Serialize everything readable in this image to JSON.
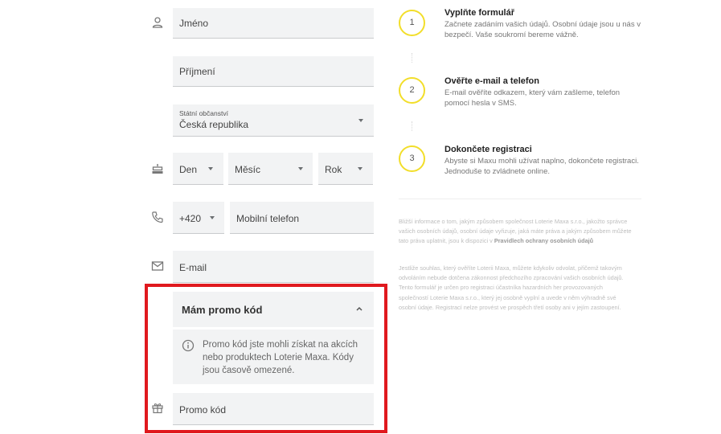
{
  "form": {
    "first_name_placeholder": "Jméno",
    "last_name_placeholder": "Příjmení",
    "citizenship": {
      "label": "Státní občanství",
      "value": "Česká republika"
    },
    "birth_date": {
      "day": "Den",
      "month": "Měsíc",
      "year": "Rok"
    },
    "phone": {
      "prefix": "+420",
      "placeholder": "Mobilní telefon"
    },
    "email_placeholder": "E-mail",
    "promo": {
      "toggle_label": "Mám promo kód",
      "info_text": "Promo kód jste mohli získat na akcích nebo produktech Loterie Maxa. Kódy jsou časově omezené.",
      "input_placeholder": "Promo kód"
    }
  },
  "steps": [
    {
      "number": "1",
      "title": "Vyplňte formulář",
      "description": "Začnete zadáním vašich údajů. Osobní údaje jsou u nás v bezpečí. Vaše soukromí bereme vážně."
    },
    {
      "number": "2",
      "title": "Ověřte e-mail a telefon",
      "description": "E-mail ověříte odkazem, který vám zašleme, telefon pomocí hesla v SMS."
    },
    {
      "number": "3",
      "title": "Dokončete registraci",
      "description": "Abyste si Maxu mohli užívat naplno, dokončete registraci. Jednoduše to zvládnete online."
    }
  ],
  "legal": {
    "paragraph1_text": "Bližší informace o tom, jakým způsobem společnost Loterie Maxa s.r.o., jakožto správce vašich osobních údajů, osobní údaje vyřizuje, jaká máte práva a jakým způsobem můžete tato práva uplatnit, jsou k dispozici v",
    "paragraph1_link": "Pravidlech ochrany osobních údajů",
    "paragraph2_text": "Jestliže souhlas, který ověříte Loterii Maxa, můžete kdykoliv odvolat, přičemž takovým odvoláním nebude dotčena zákonnost předchozího zpracování vašich osobních údajů. Tento formulář je určen pro registraci účastníka hazardních her provozovaných společností Loterie Maxa s.r.o., který jej osobně vyplní a uvede v něm výhradně své osobní údaje. Registrací nelze provést ve prospěch třetí osoby ani v jejím zastoupení."
  },
  "colors": {
    "accent": "#f2de2a",
    "highlight": "#e0191e",
    "field_bg": "#f2f3f4"
  },
  "icons": [
    "person-icon",
    "cake-icon",
    "phone-icon",
    "mail-icon",
    "info-icon",
    "gift-icon",
    "chevron-up-icon"
  ]
}
